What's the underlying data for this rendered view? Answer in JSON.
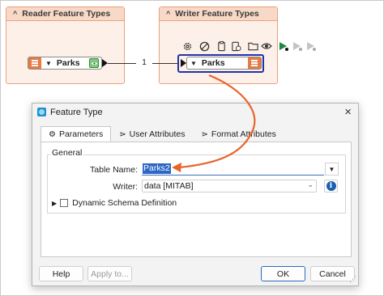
{
  "canvas": {
    "reader_bookmark": {
      "title": "Reader Feature Types",
      "feature": "Parks"
    },
    "writer_bookmark": {
      "title": "Writer Feature Types",
      "feature": "Parks"
    },
    "connection_count": "1",
    "toolbar_icons": [
      "gear-icon",
      "block-icon",
      "clipboard-icon",
      "clipboard-clock-icon",
      "folder-icon",
      "eye-icon",
      "run-icon",
      "run-disabled-icon",
      "run-options-icon"
    ],
    "colors": {
      "bookmark_fill": "#fdf0e8",
      "bookmark_border": "#e9a27b",
      "feature_tag": "#e47c45",
      "selection": "#2233aa",
      "arrow": "#e8642c"
    }
  },
  "dialog": {
    "title": "Feature Type",
    "tabs": [
      "Parameters",
      "User Attributes",
      "Format Attributes"
    ],
    "group_title": "General",
    "table_name": {
      "label": "Table Name:",
      "value": "Parks2"
    },
    "writer": {
      "label": "Writer:",
      "value": "data [MITAB]"
    },
    "dynamic_schema": {
      "label": "Dynamic Schema Definition",
      "checked": false
    },
    "buttons": {
      "help": "Help",
      "apply": "Apply to...",
      "ok": "OK",
      "cancel": "Cancel"
    }
  }
}
